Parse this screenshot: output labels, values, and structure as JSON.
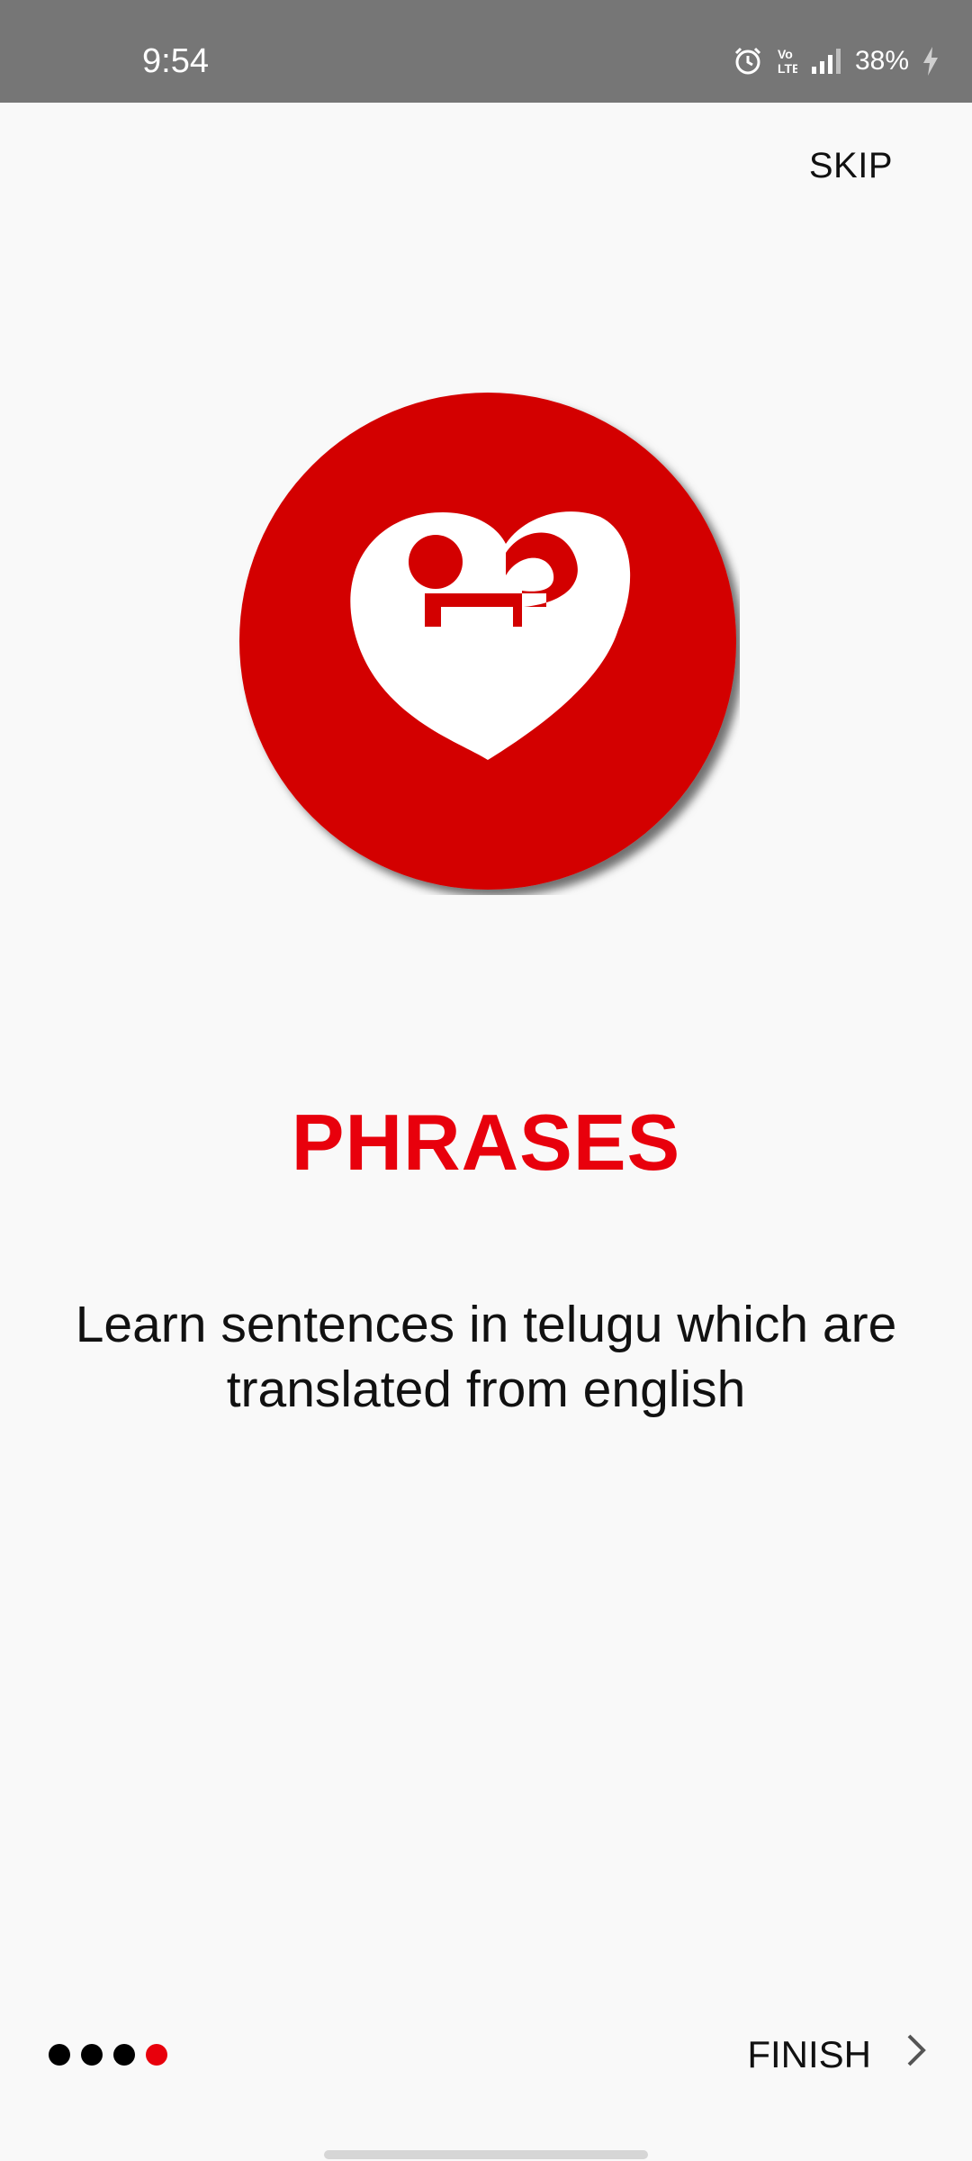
{
  "status_bar": {
    "time": "9:54",
    "battery": "38%",
    "icons": [
      "alarm-icon",
      "volte-icon",
      "signal-icon",
      "battery-charging-icon"
    ]
  },
  "header": {
    "skip_label": "SKIP"
  },
  "slide": {
    "logo_icon": "telugu-letter-logo",
    "title": "PHRASES",
    "description": "Learn sentences in telugu which are translated from english"
  },
  "footer": {
    "page_indicator": {
      "count": 4,
      "current": 4
    },
    "finish_label": "FINISH"
  },
  "colors": {
    "accent": "#e8000c",
    "logo_red": "#d30000",
    "status_bar": "#767676",
    "background": "#f9f9f9"
  }
}
